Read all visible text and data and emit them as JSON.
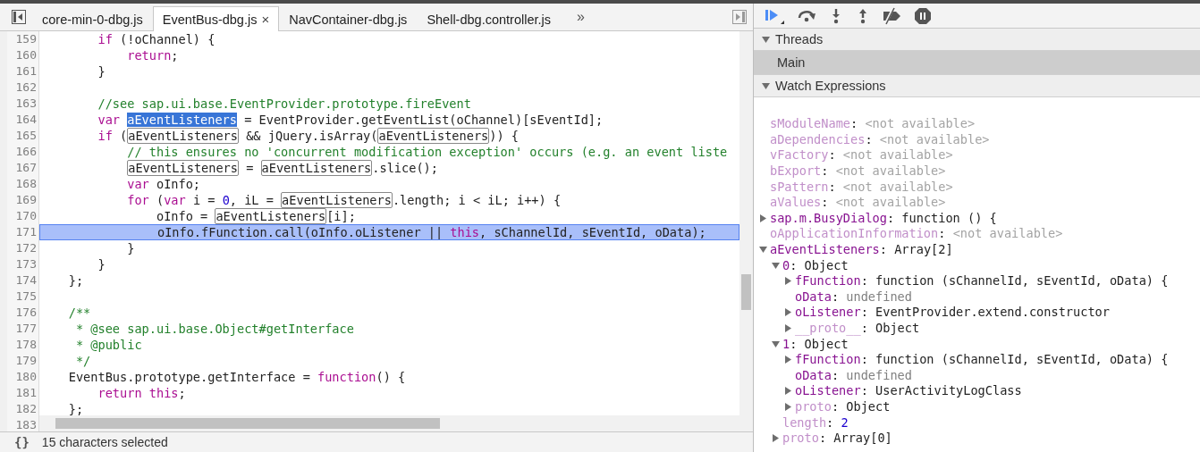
{
  "editor": {
    "tabs": [
      {
        "label": "core-min-0-dbg.js",
        "selected": false
      },
      {
        "label": "EventBus-dbg.js",
        "selected": true,
        "close": "×"
      },
      {
        "label": "NavContainer-dbg.js",
        "selected": false
      },
      {
        "label": "Shell-dbg.controller.js",
        "selected": false
      }
    ],
    "overflow": "»",
    "lines": [
      {
        "number": "159",
        "current": false,
        "tokens": [
          {
            "text": "        if",
            "kind": "keyword"
          },
          {
            "text": " (!oChannel) {"
          }
        ]
      },
      {
        "number": "160",
        "current": false,
        "tokens": [
          {
            "text": "            return",
            "kind": "keyword"
          },
          {
            "text": ";"
          }
        ]
      },
      {
        "number": "161",
        "current": false,
        "tokens": [
          {
            "text": "        }"
          }
        ]
      },
      {
        "number": "162",
        "current": false
      },
      {
        "number": "163",
        "current": false,
        "tokens": [
          {
            "text": "        //see sap.ui.base.EventProvider.prototype.fireEvent",
            "kind": "comment"
          }
        ]
      },
      {
        "number": "164",
        "current": false,
        "tokens": [
          {
            "text": "        var ",
            "kind": "keyword"
          },
          {
            "text": "aEventListeners",
            "kind": "selection"
          },
          {
            "text": " = EventProvider.getEventList(oChannel)[sEventId];"
          }
        ]
      },
      {
        "number": "165",
        "current": false,
        "tokens": [
          {
            "text": "        if",
            "kind": "keyword"
          },
          {
            "text": " ("
          },
          {
            "text": "aEventListeners",
            "kind": "match"
          },
          {
            "text": " && jQuery.isArray("
          },
          {
            "text": "aEventListeners",
            "kind": "match"
          },
          {
            "text": ")) {"
          }
        ]
      },
      {
        "number": "166",
        "current": false,
        "tokens": [
          {
            "text": "            // this ensures no 'concurrent modification exception' occurs (e.g. an event liste",
            "kind": "comment"
          }
        ]
      },
      {
        "number": "167",
        "current": false,
        "tokens": [
          {
            "text": "            aEventListeners",
            "kind": "match"
          },
          {
            "text": " = "
          },
          {
            "text": "aEventListeners",
            "kind": "match"
          },
          {
            "text": ".slice();"
          }
        ]
      },
      {
        "number": "168",
        "current": false,
        "tokens": [
          {
            "text": "            var",
            "kind": "keyword"
          },
          {
            "text": " oInfo;"
          }
        ]
      },
      {
        "number": "169",
        "current": false,
        "tokens": [
          {
            "text": "            for",
            "kind": "keyword"
          },
          {
            "text": " ("
          },
          {
            "text": "var",
            "kind": "keyword"
          },
          {
            "text": " i = "
          },
          {
            "text": "0",
            "kind": "number"
          },
          {
            "text": ", iL = "
          },
          {
            "text": "aEventListeners",
            "kind": "match"
          },
          {
            "text": ".length; i < iL; i++) {"
          }
        ]
      },
      {
        "number": "170",
        "current": false,
        "tokens": [
          {
            "text": "                oInfo = "
          },
          {
            "text": "aEventListeners",
            "kind": "match"
          },
          {
            "text": "[i];"
          }
        ]
      },
      {
        "number": "171",
        "current": true,
        "tokens": [
          {
            "text": "                oInfo.fFunction.call(oInfo.oListener || "
          },
          {
            "text": "this",
            "kind": "keyword"
          },
          {
            "text": ", sChannelId, sEventId, oData);"
          }
        ]
      },
      {
        "number": "172",
        "current": false,
        "tokens": [
          {
            "text": "            }"
          }
        ]
      },
      {
        "number": "173",
        "current": false,
        "tokens": [
          {
            "text": "        }"
          }
        ]
      },
      {
        "number": "174",
        "current": false,
        "tokens": [
          {
            "text": "    };"
          }
        ]
      },
      {
        "number": "175",
        "current": false
      },
      {
        "number": "176",
        "current": false,
        "tokens": [
          {
            "text": "    /**",
            "kind": "comment"
          }
        ]
      },
      {
        "number": "177",
        "current": false,
        "tokens": [
          {
            "text": "     * @see sap.ui.base.Object#getInterface",
            "kind": "comment"
          }
        ]
      },
      {
        "number": "178",
        "current": false,
        "tokens": [
          {
            "text": "     * @public",
            "kind": "comment"
          }
        ]
      },
      {
        "number": "179",
        "current": false,
        "tokens": [
          {
            "text": "     */",
            "kind": "comment"
          }
        ]
      },
      {
        "number": "180",
        "current": false,
        "tokens": [
          {
            "text": "    EventBus.prototype.getInterface = "
          },
          {
            "text": "function",
            "kind": "keyword"
          },
          {
            "text": "() {"
          }
        ]
      },
      {
        "number": "181",
        "current": false,
        "tokens": [
          {
            "text": "        return this",
            "kind": "keyword"
          },
          {
            "text": ";"
          }
        ]
      },
      {
        "number": "182",
        "current": false,
        "tokens": [
          {
            "text": "    };"
          }
        ]
      },
      {
        "number": "183"
      }
    ],
    "status": {
      "format_button": "{}",
      "selection": "15 characters selected"
    }
  },
  "debugger": {
    "threads": {
      "title": "Threads",
      "expanded": true,
      "items": [
        {
          "label": "Main",
          "selected": true
        }
      ]
    },
    "watch": {
      "title": "Watch Expressions",
      "expanded": true,
      "separator": ":",
      "items": [
        {
          "name": "sModuleName",
          "value": "<not available>",
          "kind": "unavailable",
          "dimmed": true
        },
        {
          "name": "aDependencies",
          "value": "<not available>",
          "kind": "unavailable",
          "dimmed": true
        },
        {
          "name": "vFactory",
          "value": "<not available>",
          "kind": "unavailable",
          "dimmed": true
        },
        {
          "name": "bExport",
          "value": "<not available>",
          "kind": "unavailable",
          "dimmed": true
        },
        {
          "name": "sPattern",
          "value": "<not available>",
          "kind": "unavailable",
          "dimmed": true
        },
        {
          "name": "aValues",
          "value": "<not available>",
          "kind": "unavailable",
          "dimmed": true
        },
        {
          "name": "sap.m.BusyDialog",
          "value": "function () {",
          "kind": "object",
          "dimmed": false,
          "expanded": false
        },
        {
          "name": "oApplicationInformation",
          "value": "<not available>",
          "kind": "unavailable",
          "dimmed": true
        },
        {
          "name": "aEventListeners",
          "value": "Array[2]",
          "kind": "object",
          "dimmed": false,
          "expanded": true,
          "children": [
            {
              "name": "0",
              "value": "Object",
              "kind": "object",
              "dimmed": false,
              "expanded": true,
              "children": [
                {
                  "name": "fFunction",
                  "value": "function (sChannelId, sEventId, oData) {",
                  "kind": "object",
                  "dimmed": false,
                  "expanded": false
                },
                {
                  "name": "oData",
                  "value": "undefined",
                  "kind": "undefined",
                  "dimmed": false
                },
                {
                  "name": "oListener",
                  "value": "EventProvider.extend.constructor",
                  "kind": "object",
                  "dimmed": false,
                  "expanded": false
                },
                {
                  "name": "__proto__",
                  "value": "Object",
                  "kind": "object",
                  "dimmed": true,
                  "expanded": false
                }
              ]
            },
            {
              "name": "1",
              "value": "Object",
              "kind": "object",
              "dimmed": false,
              "expanded": true,
              "children": [
                {
                  "name": "fFunction",
                  "value": "function (sChannelId, sEventId, oData) {",
                  "kind": "object",
                  "dimmed": false,
                  "expanded": false
                },
                {
                  "name": "oData",
                  "value": "undefined",
                  "kind": "undefined",
                  "dimmed": false
                },
                {
                  "name": "oListener",
                  "value": "UserActivityLogClass",
                  "kind": "object",
                  "dimmed": false,
                  "expanded": false
                },
                {
                  "name": "proto",
                  "value": "Object",
                  "kind": "object",
                  "dimmed": true,
                  "expanded": false
                }
              ]
            },
            {
              "name": "length",
              "value": "2",
              "kind": "number",
              "dimmed": true
            },
            {
              "name": "proto",
              "value": "Array[0]",
              "kind": "object",
              "dimmed": true,
              "expanded": false
            }
          ]
        }
      ]
    }
  }
}
